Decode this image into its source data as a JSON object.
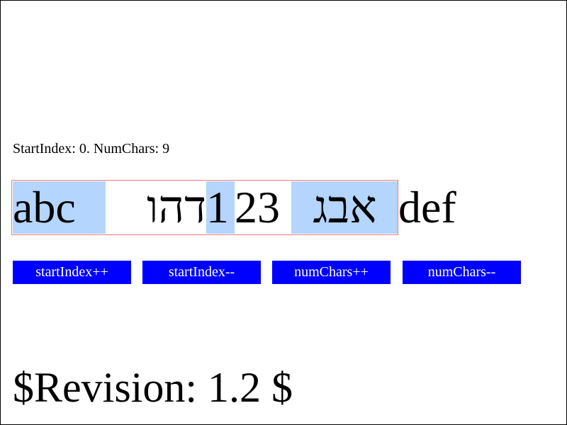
{
  "status": {
    "start_label": "StartIndex:",
    "start_value": "0",
    "num_label": "NumChars:",
    "num_value": "9"
  },
  "text_runs": {
    "latin_1": "abc ",
    "hebrew_1": "דהו",
    "digit_1": "1",
    "digits_rest": "23",
    "hebrew_2": "אבג",
    "latin_2": " def"
  },
  "buttons": {
    "start_inc": "startIndex++",
    "start_dec": "startIndex--",
    "num_inc": "numChars++",
    "num_dec": "numChars--"
  },
  "revision": "$Revision: 1.2 $",
  "colors": {
    "highlight": "#b4d5fe",
    "selection_border": "#f0787a",
    "button_bg": "#0000ff",
    "button_text": "#ffffff"
  }
}
